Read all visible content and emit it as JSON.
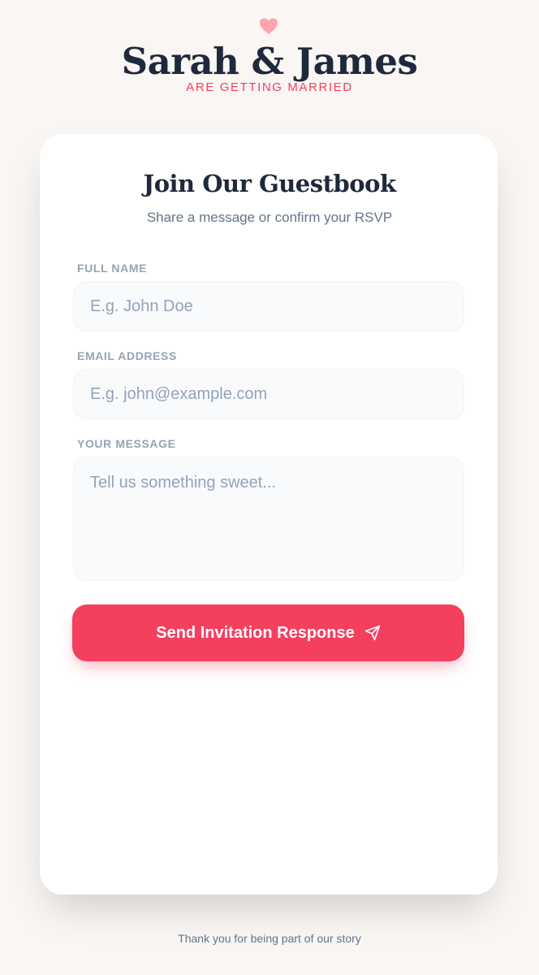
{
  "header": {
    "icon": "heart-icon",
    "title": "Sarah & James",
    "tagline": "ARE GETTING MARRIED"
  },
  "card": {
    "title": "Join Our Guestbook",
    "subtitle": "Share a message or confirm your RSVP"
  },
  "form": {
    "name": {
      "label": "FULL NAME",
      "placeholder": "E.g. John Doe",
      "value": ""
    },
    "email": {
      "label": "EMAIL ADDRESS",
      "placeholder": "E.g. john@example.com",
      "value": ""
    },
    "message": {
      "label": "YOUR MESSAGE",
      "placeholder": "Tell us something sweet...",
      "value": ""
    },
    "submit_label": "Send Invitation Response",
    "submit_icon": "send-icon"
  },
  "footer": {
    "text": "Thank you for being part of our story"
  },
  "colors": {
    "accent": "#f43f5e",
    "heart": "#fda4af",
    "heading": "#1e293b",
    "muted": "#64748b",
    "label": "#94a3b8",
    "background": "#f9f6f4"
  }
}
